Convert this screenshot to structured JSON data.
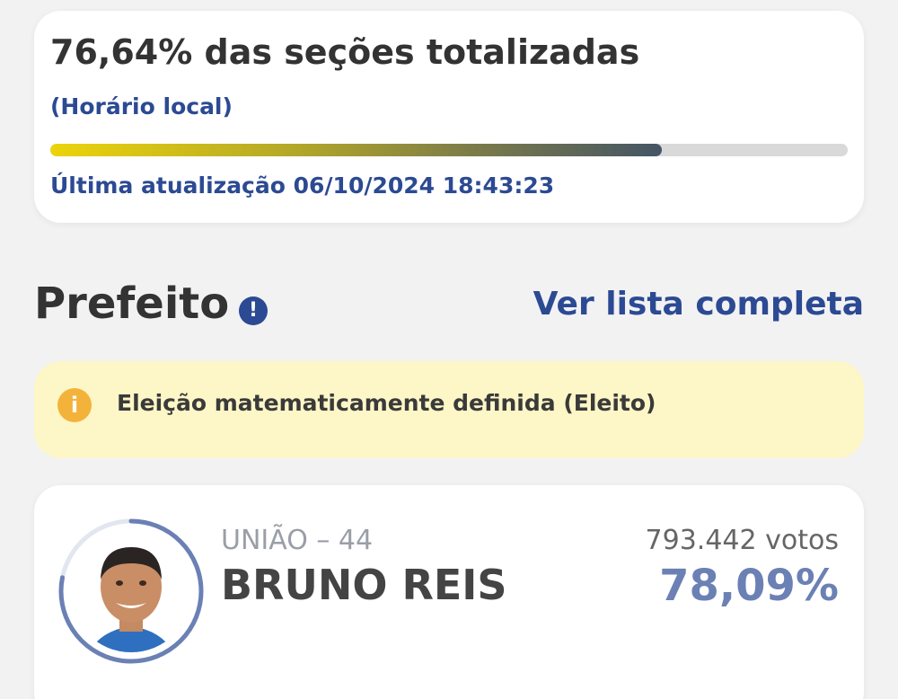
{
  "progress": {
    "sections_text": "76,64% das seções totalizadas",
    "sections_percent": 76.64,
    "local_time_label": "(Horário local)",
    "last_update": "Última atualização 06/10/2024 18:43:23"
  },
  "office": {
    "title": "Prefeito",
    "info_icon": "info-icon",
    "full_list_link": "Ver lista completa"
  },
  "status": {
    "icon": "warning-icon",
    "text": "Eleição matematicamente definida (Eleito)"
  },
  "candidate": {
    "party": "UNIÃO – 44",
    "name": "BRUNO REIS",
    "votes": "793.442 votos",
    "percent": "78,09%",
    "percent_value": 78.09,
    "avatar": "candidate-photo"
  },
  "colors": {
    "accent": "#2c4a93",
    "percent_color": "#6b80b4",
    "banner_bg": "#fdf6c6",
    "warning": "#f3b33a",
    "bar_start": "#ecd40a",
    "bar_end": "#445565"
  }
}
